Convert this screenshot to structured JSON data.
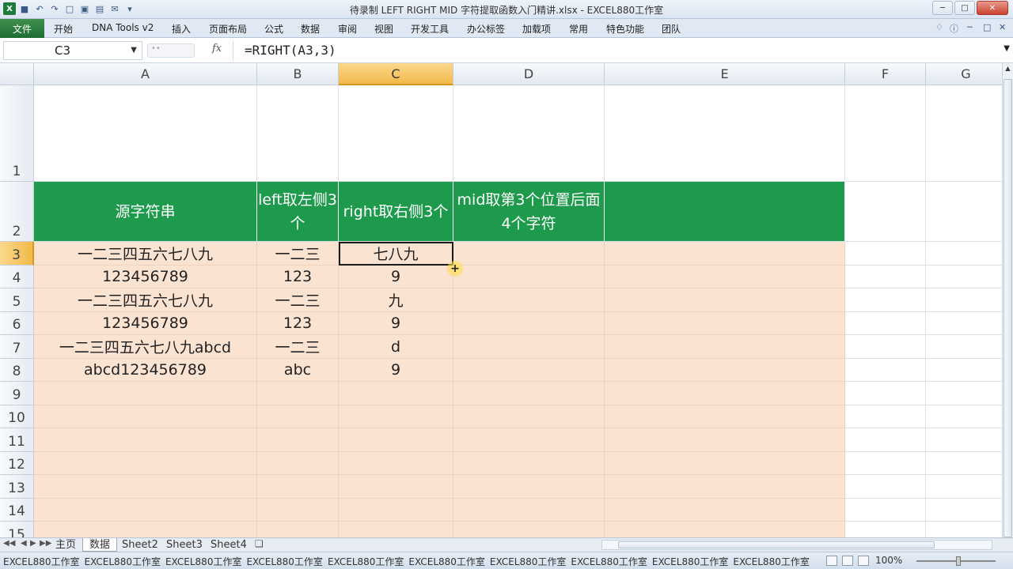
{
  "window": {
    "title": "待录制 LEFT RIGHT MID 字符提取函数入门精讲.xlsx - EXCEL880工作室",
    "qat_logo": "X"
  },
  "ribbon": {
    "file": "文件",
    "tabs": [
      "开始",
      "DNA Tools v2",
      "插入",
      "页面布局",
      "公式",
      "数据",
      "审阅",
      "视图",
      "开发工具",
      "办公标签",
      "加载项",
      "常用",
      "特色功能",
      "团队"
    ]
  },
  "formula_bar": {
    "name_box": "C3",
    "fx": "fx",
    "formula": "=RIGHT(A3,3)"
  },
  "columns": [
    "A",
    "B",
    "C",
    "D",
    "E",
    "F",
    "G"
  ],
  "rows": [
    "1",
    "2",
    "3",
    "4",
    "5",
    "6",
    "7",
    "8",
    "9",
    "10",
    "11",
    "12",
    "13",
    "14",
    "15"
  ],
  "active_cell": "C3",
  "table": {
    "headers": [
      "源字符串",
      "left取左侧3个",
      "right取右侧3个",
      "mid取第3个位置后面4个字符",
      ""
    ],
    "rows": [
      [
        "一二三四五六七八九",
        "一二三",
        "七八九",
        "",
        ""
      ],
      [
        "123456789",
        "123",
        "9",
        "",
        ""
      ],
      [
        "一二三四五六七八九",
        "一二三",
        "九",
        "",
        ""
      ],
      [
        "123456789",
        "123",
        "9",
        "",
        ""
      ],
      [
        "一二三四五六七八九abcd",
        "一二三",
        "d",
        "",
        ""
      ],
      [
        "abcd123456789",
        "abc",
        "9",
        "",
        ""
      ]
    ],
    "header_color": "#1e9a4d",
    "fill_color": "#fbe3d1"
  },
  "sheets": [
    "主页",
    "数据",
    "Sheet2",
    "Sheet3",
    "Sheet4"
  ],
  "active_sheet": "数据",
  "status": {
    "items": [
      "EXCEL880工作室",
      "EXCEL880工作室",
      "EXCEL880工作室",
      "EXCEL880工作室",
      "EXCEL880工作室",
      "EXCEL880工作室",
      "EXCEL880工作室",
      "EXCEL880工作室",
      "EXCEL880工作室",
      "EXCEL880工作室"
    ],
    "zoom": "100%"
  }
}
